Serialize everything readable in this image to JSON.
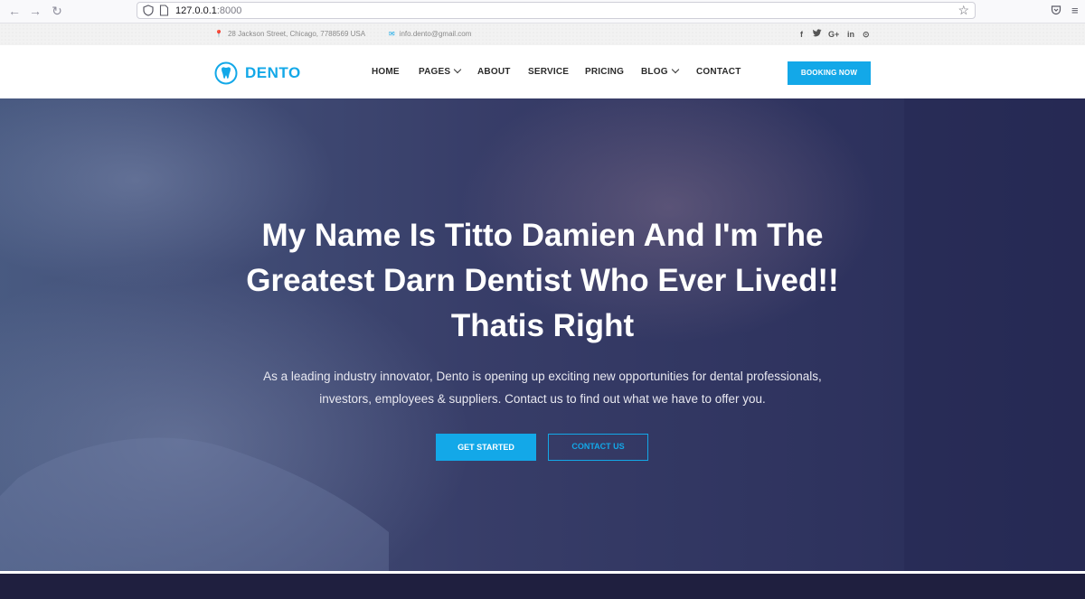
{
  "browser": {
    "url_host": "127.0.0.1",
    "url_port": ":8000"
  },
  "topbar": {
    "address": "28 Jackson Street, Chicago, 7788569 USA",
    "email": "info.dento@gmail.com",
    "social": [
      "facebook-icon",
      "twitter-icon",
      "google-plus-icon",
      "linkedin-icon",
      "pinterest-icon"
    ],
    "social_glyphs": {
      "facebook": "f",
      "twitter": "🐦",
      "google": "G+",
      "linkedin": "in",
      "pinterest": "⊙"
    }
  },
  "header": {
    "logo_text": "DENTO",
    "menu": {
      "home": "HOME",
      "pages": "PAGES",
      "about": "ABOUT",
      "service": "SERVICE",
      "pricing": "PRICING",
      "blog": "BLOG",
      "contact": "CONTACT"
    },
    "booking": "BOOKING NOW"
  },
  "hero": {
    "title_line1": "My Name Is Titto Damien And I'm The",
    "title_line2": "Greatest Darn Dentist Who Ever Lived!!",
    "title_line3": "Thatis Right",
    "subtitle_line1": "As a leading industry innovator, Dento is opening up exciting new opportunities for dental professionals,",
    "subtitle_line2": "investors, employees & suppliers. Contact us to find out what we have to offer you.",
    "primary_button": "GET STARTED",
    "secondary_button": "CONTACT US"
  },
  "colors": {
    "accent": "#13a8e8",
    "hero_overlay": "#2c3160",
    "footer": "#1f1f3f"
  }
}
